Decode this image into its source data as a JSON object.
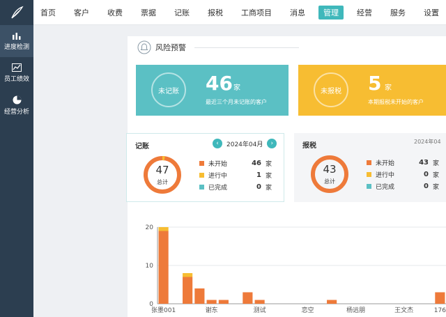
{
  "colors": {
    "sidebar": "#2c3e50",
    "teal": "#3fb8bb",
    "orange": "#ee7a3a",
    "yellow": "#f7bd32",
    "blue": "#5bc0c4"
  },
  "sidebar": {
    "items": [
      {
        "label": "进度检测",
        "icon": "bar-chart-icon"
      },
      {
        "label": "员工绩效",
        "icon": "line-chart-icon"
      },
      {
        "label": "经营分析",
        "icon": "pie-chart-icon"
      }
    ]
  },
  "nav": {
    "items": [
      "首页",
      "客户",
      "收费",
      "票据",
      "记账",
      "报税",
      "工商项目",
      "消息",
      "管理",
      "经营",
      "服务",
      "设置"
    ],
    "active": "管理"
  },
  "risk": {
    "title": "风险预警",
    "unrecorded": {
      "label": "未记账",
      "count": "46",
      "unit": "家",
      "desc": "最近三个月未记账的客户"
    },
    "unfiled": {
      "label": "未报税",
      "count": "5",
      "unit": "家",
      "desc": "本期报税未开始的客户"
    }
  },
  "bookkeeping": {
    "title": "记账",
    "month": "2024年04月",
    "total": "47",
    "total_label": "总计",
    "rows": [
      {
        "label": "未开始",
        "value": "46",
        "unit": "家",
        "color": "#ee7a3a"
      },
      {
        "label": "进行中",
        "value": "1",
        "unit": "家",
        "color": "#f7bd32"
      },
      {
        "label": "已完成",
        "value": "0",
        "unit": "家",
        "color": "#5bc0c4"
      }
    ]
  },
  "tax": {
    "title": "报税",
    "month": "2024年04",
    "total": "43",
    "total_label": "总计",
    "rows": [
      {
        "label": "未开始",
        "value": "43",
        "unit": "家",
        "color": "#ee7a3a"
      },
      {
        "label": "进行中",
        "value": "0",
        "unit": "家",
        "color": "#f7bd32"
      },
      {
        "label": "已完成",
        "value": "0",
        "unit": "家",
        "color": "#5bc0c4"
      }
    ]
  },
  "chart_data": {
    "type": "bar",
    "ylim": [
      0,
      20
    ],
    "yticks": [
      0,
      10,
      20
    ],
    "xtick_labels": [
      {
        "index": 0,
        "label": "张墨001"
      },
      {
        "index": 4,
        "label": "谢东"
      },
      {
        "index": 8,
        "label": "测试"
      },
      {
        "index": 12,
        "label": "恋空"
      },
      {
        "index": 16,
        "label": "杨远朋"
      },
      {
        "index": 20,
        "label": "王文杰"
      },
      {
        "index": 23,
        "label": "176"
      }
    ],
    "series": [
      {
        "values": [
          19,
          0,
          7,
          4,
          1,
          1,
          0,
          3,
          1,
          0,
          0,
          0,
          0,
          0,
          1,
          0,
          0,
          0,
          0,
          0,
          0,
          0,
          0,
          3
        ],
        "color": "#ee7a3a"
      },
      {
        "values": [
          1,
          0,
          1,
          0,
          0,
          0,
          0,
          0,
          0,
          0,
          0,
          0,
          0,
          0,
          0,
          0,
          0,
          0,
          0,
          0,
          0,
          0,
          0,
          0
        ],
        "color": "#f7bd32"
      }
    ]
  }
}
